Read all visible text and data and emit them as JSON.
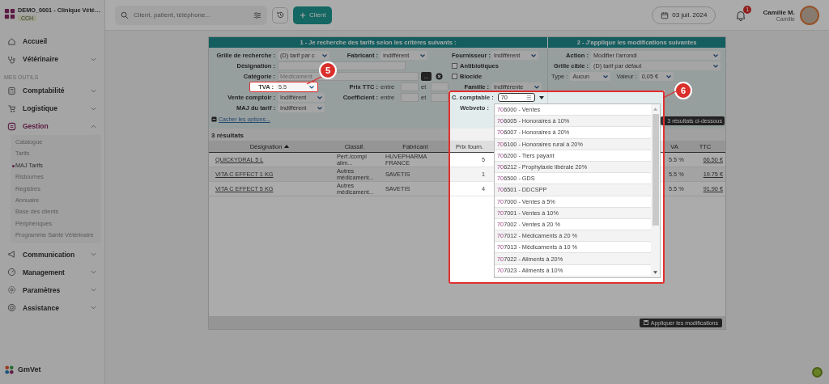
{
  "sidebar": {
    "clinic": "DEMO_0001 - Clinique Vété…",
    "badge": "CCH",
    "top_items": [
      {
        "label": "Accueil",
        "kind": "link"
      },
      {
        "label": "Vétérinaire",
        "kind": "group",
        "expanded": false
      }
    ],
    "section": "MES OUTILS",
    "items": [
      {
        "label": "Comptabilité",
        "expanded": false,
        "selected": false
      },
      {
        "label": "Logistique",
        "expanded": false,
        "selected": false
      },
      {
        "label": "Gestion",
        "expanded": true,
        "selected": true,
        "children": [
          {
            "label": "Catalogue",
            "selected": false
          },
          {
            "label": "Tarifs",
            "selected": false
          },
          {
            "label": "MAJ Tarifs",
            "selected": true
          },
          {
            "label": "Ristournes",
            "selected": false
          },
          {
            "label": "Registres",
            "selected": false
          },
          {
            "label": "Annuaire",
            "selected": false
          },
          {
            "label": "Base des clients",
            "selected": false
          },
          {
            "label": "Périphériques",
            "selected": false
          },
          {
            "label": "Programme Santé Vétérinaire",
            "selected": false
          }
        ]
      },
      {
        "label": "Communication",
        "expanded": false,
        "selected": false
      },
      {
        "label": "Management",
        "expanded": false,
        "selected": false
      },
      {
        "label": "Paramètres",
        "expanded": false,
        "selected": false
      },
      {
        "label": "Assistance",
        "expanded": false,
        "selected": false
      }
    ],
    "brand": "GmVet"
  },
  "topbar": {
    "search_placeholder": "Client, patient, téléphone...",
    "client_button": "Client",
    "date": "03 juil. 2024",
    "notifications": "1",
    "user_name": "Camille M.",
    "user_role": "Camille"
  },
  "search_header": "1 - Je recherche des tarifs selon les critères suivants :",
  "apply_header": "2 - J'applique les modifications suivantes",
  "criteria": {
    "grille": {
      "label": "Grille de recherche :",
      "value": "(D) tarif par c"
    },
    "fabricant": {
      "label": "Fabricant :",
      "value": "Indifférent"
    },
    "designation": {
      "label": "Désignation :"
    },
    "categorie": {
      "label": "Catégorie :",
      "placeholder": "Médicament",
      "browse": "..."
    },
    "tva": {
      "label": "TVA :",
      "value": "5.5",
      "highlighted": true
    },
    "prix_ttc": {
      "label": "Prix TTC :",
      "from": "entre",
      "to": "et"
    },
    "vente_comptoir": {
      "label": "Vente comptoir :",
      "value": "Indifférent"
    },
    "coefficient": {
      "label": "Coefficient :",
      "from": "entre",
      "to": "et"
    },
    "maj_tarif": {
      "label": "MAJ du tarif :",
      "value": "Indifférent"
    },
    "fournisseur": {
      "label": "Fournisseur :",
      "value": "Indifférent"
    },
    "checkboxes": [
      {
        "label": "Antibiotiques",
        "checked": false
      },
      {
        "label": "Biocide",
        "checked": false
      }
    ],
    "famille": {
      "label": "Famille :",
      "value": "Indifférente"
    },
    "compte": {
      "label": "C. comptable :",
      "value": "70"
    },
    "webveto": {
      "label": "Webveto :"
    }
  },
  "hide_options": "Cacher les options...",
  "modifications": {
    "action": {
      "label": "Action :",
      "value": "Modifier l'arrondi"
    },
    "grille_cible": {
      "label": "Grille cible :",
      "value": "(D) tarif par défaut"
    },
    "type": {
      "label": "Type :",
      "value": "Aucun"
    },
    "valeur": {
      "label": "Valeur :",
      "value": "0,05 €"
    }
  },
  "results_button": "3 résultats ci-dessous",
  "suggestions": [
    "706000 - Ventes",
    "706005 - Honoraires à 10%",
    "706007 - Honoraires à 20%",
    "706100 - Honoraires rural à 20%",
    "706200 - Tiers payant",
    "706212 - Prophylaxie libérale 20%",
    "706500 - GDS",
    "706501 - DDCSPP",
    "707000 - Ventes à 5%",
    "707001 - Ventes à 10%",
    "707002 - Ventes à 20 %",
    "707012 - Médicaments à 20 %",
    "707013 - Médicaments à 10 %",
    "707022 - Aliments à 20%",
    "707023 - Aliments à 10%"
  ],
  "results": {
    "count": "3 résultats",
    "columns": [
      {
        "label": "Désignation",
        "sorted": true
      },
      {
        "label": "Classif.",
        "sorted": false
      },
      {
        "label": "Fabricant",
        "sorted": false
      },
      {
        "label": "Prix fourn.",
        "sorted": false
      },
      {
        "label": "VA",
        "sorted": false
      },
      {
        "label": "TTC",
        "sorted": false
      }
    ],
    "rows": [
      [
        "QUICKYDRAL 5 L",
        "Perf./compl alim...",
        "HUVEPHARMA FRANCE",
        "5",
        "5.5 %",
        "66.50 €"
      ],
      [
        "VITA C EFFECT 1 KG",
        "Autres médicament...",
        "SAVETIS",
        "1",
        "5.5 %",
        "19.75 €"
      ],
      [
        "VITA C EFFECT 5 KG",
        "Autres médicament...",
        "SAVETIS",
        "4",
        "5.5 %",
        "91.90 €"
      ]
    ]
  },
  "apply_button": "Appliquer les modifications",
  "callouts": [
    "5",
    "6"
  ]
}
